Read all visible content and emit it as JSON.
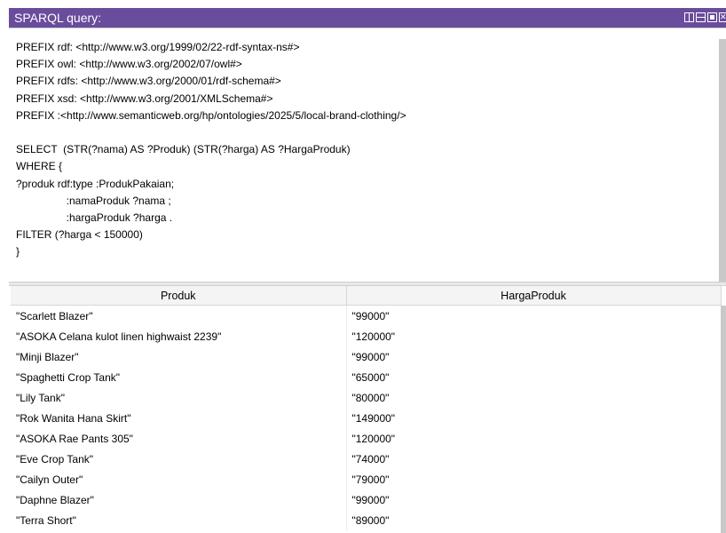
{
  "window": {
    "title": "SPARQL query:",
    "accent": "#6a4c9c"
  },
  "query": {
    "text": "PREFIX rdf: <http://www.w3.org/1999/02/22-rdf-syntax-ns#>\nPREFIX owl: <http://www.w3.org/2002/07/owl#>\nPREFIX rdfs: <http://www.w3.org/2000/01/rdf-schema#>\nPREFIX xsd: <http://www.w3.org/2001/XMLSchema#>\nPREFIX :<http://www.semanticweb.org/hp/ontologies/2025/5/local-brand-clothing/>\n\nSELECT  (STR(?nama) AS ?Produk) (STR(?harga) AS ?HargaProduk)\nWHERE {\n?produk rdf:type :ProdukPakaian;\n                 :namaProduk ?nama ;\n                 :hargaProduk ?harga .\nFILTER (?harga < 150000)\n}"
  },
  "results": {
    "columns": [
      "Produk",
      "HargaProduk"
    ],
    "rows": [
      [
        "\"Scarlett Blazer\"",
        "\"99000\""
      ],
      [
        "\"ASOKA Celana kulot linen highwaist 2239\"",
        "\"120000\""
      ],
      [
        "\"Minji Blazer\"",
        "\"99000\""
      ],
      [
        "\"Spaghetti Crop Tank\"",
        "\"65000\""
      ],
      [
        "\"Lily Tank\"",
        "\"80000\""
      ],
      [
        "\"Rok Wanita Hana Skirt\"",
        "\"149000\""
      ],
      [
        "\"ASOKA Rae Pants 305\"",
        "\"120000\""
      ],
      [
        "\"Eve Crop Tank\"",
        "\"74000\""
      ],
      [
        "\"Cailyn Outer\"",
        "\"79000\""
      ],
      [
        "\"Daphne Blazer\"",
        "\"99000\""
      ],
      [
        "\"Terra Short\"",
        "\"89000\""
      ]
    ]
  }
}
